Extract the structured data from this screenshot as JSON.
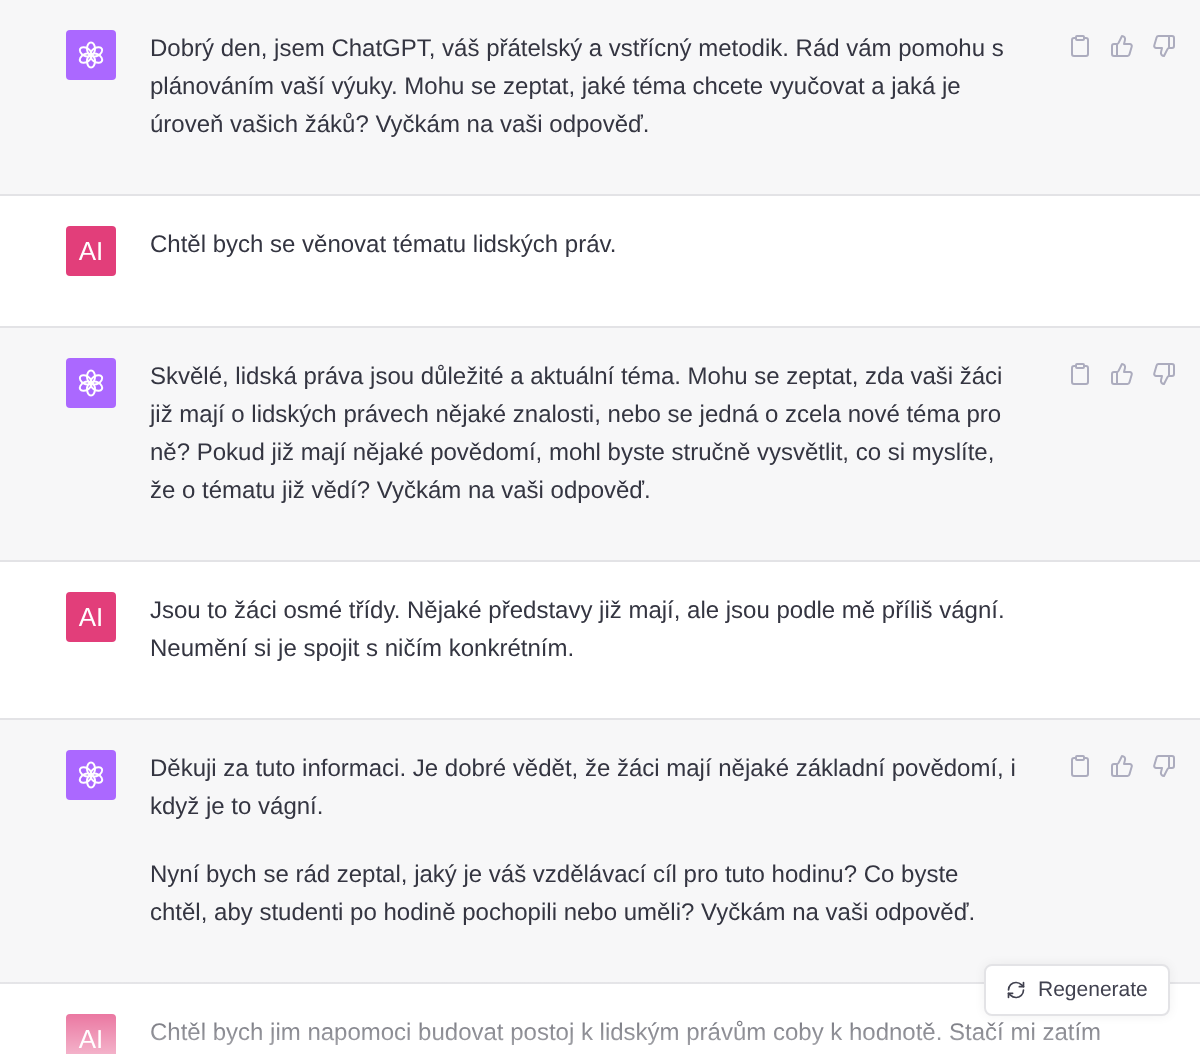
{
  "messages": [
    {
      "kind": "assistant",
      "paragraphs": [
        "Dobrý den, jsem ChatGPT, váš přátelský a vstřícný metodik. Rád vám pomohu s plánováním vaší výuky. Mohu se zeptat, jaké téma chcete vyučovat a jaká je úroveň vašich žáků? Vyčkám na vaši odpověď."
      ]
    },
    {
      "kind": "user",
      "avatar": "AI",
      "paragraphs": [
        "Chtěl bych se věnovat tématu lidských práv."
      ]
    },
    {
      "kind": "assistant",
      "paragraphs": [
        "Skvělé, lidská práva jsou důležité a aktuální téma. Mohu se zeptat, zda vaši žáci již mají o lidských právech nějaké znalosti, nebo se jedná o zcela nové téma pro ně? Pokud již mají nějaké povědomí, mohl byste stručně vysvětlit, co si myslíte, že o tématu již vědí? Vyčkám na vaši odpověď."
      ]
    },
    {
      "kind": "user",
      "avatar": "AI",
      "paragraphs": [
        "Jsou to žáci osmé třídy. Nějaké představy již mají, ale jsou podle mě příliš vágní. Neumění si je spojit s ničím konkrétním."
      ]
    },
    {
      "kind": "assistant",
      "paragraphs": [
        "Děkuji za tuto informaci. Je dobré vědět, že žáci mají nějaké základní povědomí, i když je to vágní.",
        "Nyní bych se rád zeptal, jaký je váš vzdělávací cíl pro tuto hodinu? Co byste chtěl, aby studenti po hodině pochopili nebo uměli? Vyčkám na vaši odpověď."
      ]
    },
    {
      "kind": "user",
      "avatar": "AI",
      "paragraphs": [
        "Chtěl bych jim napomoci budovat postoj k lidským právům coby k hodnotě. Stačí mi zatím"
      ]
    }
  ],
  "regenerate_button": {
    "label": "Regenerate"
  }
}
